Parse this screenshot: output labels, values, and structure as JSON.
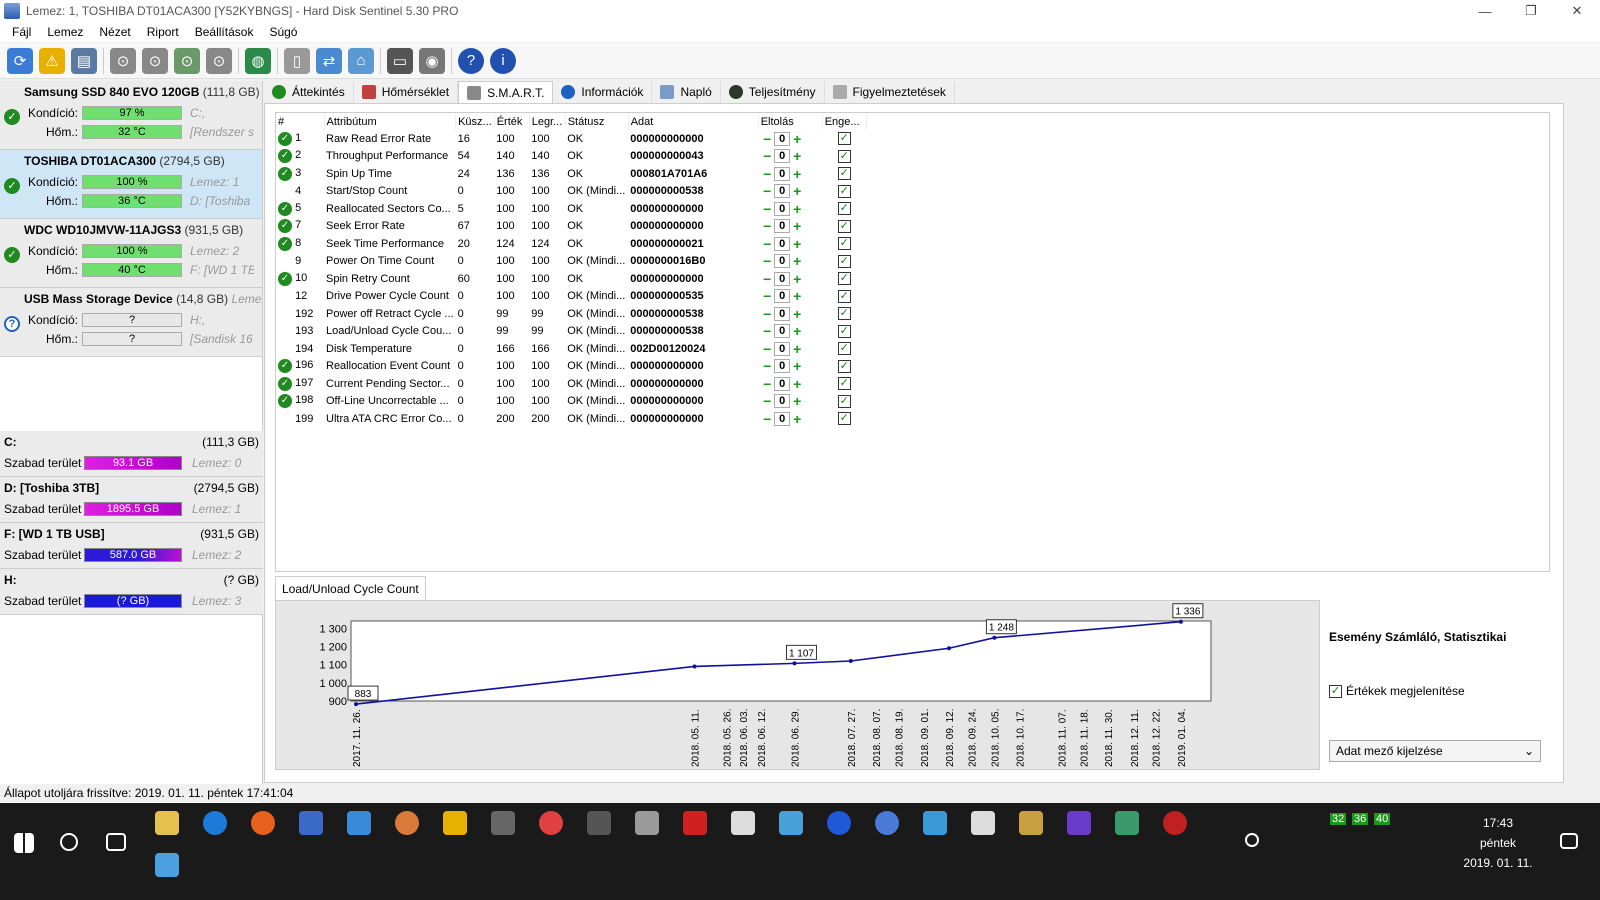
{
  "window": {
    "title": "Lemez: 1, TOSHIBA DT01ACA300 [Y52KYBNGS]  -  Hard Disk Sentinel 5.30 PRO",
    "btn_min": "—",
    "btn_max": "❐",
    "btn_close": "✕"
  },
  "menu": [
    "Fájl",
    "Lemez",
    "Nézet",
    "Riport",
    "Beállítások",
    "Súgó"
  ],
  "disks": [
    {
      "name": "Samsung SSD 840 EVO 120GB",
      "size": "(111,8 GB)",
      "tail": "Le",
      "cond_label": "Kondíció:",
      "cond": "97 %",
      "temp_label": "Hőm.:",
      "temp": "32 °C",
      "extra1": "C:,",
      "extra2": "[Rendszer sz",
      "status": "✓"
    },
    {
      "name": "TOSHIBA DT01ACA300",
      "size": "(2794,5 GB)",
      "tail": "",
      "cond_label": "Kondíció:",
      "cond": "100 %",
      "temp_label": "Hőm.:",
      "temp": "36 °C",
      "extra1": "Lemez: 1",
      "extra2": "D: [Toshiba 3",
      "status": "✓"
    },
    {
      "name": "WDC WD10JMVW-11AJGS3",
      "size": "(931,5 GB)",
      "tail": "",
      "cond_label": "Kondíció:",
      "cond": "100 %",
      "temp_label": "Hőm.:",
      "temp": "40 °C",
      "extra1": "Lemez: 2",
      "extra2": "F: [WD 1 TB U",
      "status": "✓"
    },
    {
      "name": "USB Mass Storage Device",
      "size": "(14,8 GB)",
      "tail": "Lemez",
      "cond_label": "Kondíció:",
      "cond": "?",
      "temp_label": "Hőm.:",
      "temp": "?",
      "extra1": "H:,",
      "extra2": "[Sandisk 16 G",
      "status": "?"
    }
  ],
  "partitions": [
    {
      "name": "C:",
      "size": "(111,3 GB)",
      "free_label": "Szabad terület",
      "free": "93.1 GB",
      "disk": "Lemez: 0"
    },
    {
      "name": "D: [Toshiba 3TB]",
      "size": "(2794,5 GB)",
      "free_label": "Szabad terület",
      "free": "1895.5 GB",
      "disk": "Lemez: 1"
    },
    {
      "name": "F: [WD 1 TB USB]",
      "size": "(931,5 GB)",
      "free_label": "Szabad terület",
      "free": "587.0 GB",
      "disk": "Lemez: 2"
    },
    {
      "name": "H:",
      "size": "(? GB)",
      "free_label": "Szabad terület",
      "free": "(? GB)",
      "disk": "Lemez: 3"
    }
  ],
  "tabs": [
    "Áttekintés",
    "Hőmérséklet",
    "S.M.A.R.T.",
    "Információk",
    "Napló",
    "Teljesítmény",
    "Figyelmeztetések"
  ],
  "smart_headers": [
    "#",
    "Attribútum",
    "Küsz...",
    "Érték",
    "Legr...",
    "Státusz",
    "Adat",
    "Eltolás",
    "Enge..."
  ],
  "smart_rows": [
    {
      "ok": true,
      "id": "1",
      "name": "Raw Read Error Rate",
      "thr": "16",
      "val": "100",
      "worst": "100",
      "status": "OK",
      "data": "000000000000",
      "offset": "0"
    },
    {
      "ok": true,
      "id": "2",
      "name": "Throughput Performance",
      "thr": "54",
      "val": "140",
      "worst": "140",
      "status": "OK",
      "data": "000000000043",
      "offset": "0"
    },
    {
      "ok": true,
      "id": "3",
      "name": "Spin Up Time",
      "thr": "24",
      "val": "136",
      "worst": "136",
      "status": "OK",
      "data": "000801A701A6",
      "offset": "0"
    },
    {
      "ok": false,
      "id": "4",
      "name": "Start/Stop Count",
      "thr": "0",
      "val": "100",
      "worst": "100",
      "status": "OK (Mindi...",
      "data": "000000000538",
      "offset": "0"
    },
    {
      "ok": true,
      "id": "5",
      "name": "Reallocated Sectors Co...",
      "thr": "5",
      "val": "100",
      "worst": "100",
      "status": "OK",
      "data": "000000000000",
      "offset": "0"
    },
    {
      "ok": true,
      "id": "7",
      "name": "Seek Error Rate",
      "thr": "67",
      "val": "100",
      "worst": "100",
      "status": "OK",
      "data": "000000000000",
      "offset": "0"
    },
    {
      "ok": true,
      "id": "8",
      "name": "Seek Time Performance",
      "thr": "20",
      "val": "124",
      "worst": "124",
      "status": "OK",
      "data": "000000000021",
      "offset": "0"
    },
    {
      "ok": false,
      "id": "9",
      "name": "Power On Time Count",
      "thr": "0",
      "val": "100",
      "worst": "100",
      "status": "OK (Mindi...",
      "data": "0000000016B0",
      "offset": "0"
    },
    {
      "ok": true,
      "id": "10",
      "name": "Spin Retry Count",
      "thr": "60",
      "val": "100",
      "worst": "100",
      "status": "OK",
      "data": "000000000000",
      "offset": "0"
    },
    {
      "ok": false,
      "id": "12",
      "name": "Drive Power Cycle Count",
      "thr": "0",
      "val": "100",
      "worst": "100",
      "status": "OK (Mindi...",
      "data": "000000000535",
      "offset": "0"
    },
    {
      "ok": false,
      "id": "192",
      "name": "Power off Retract Cycle ...",
      "thr": "0",
      "val": "99",
      "worst": "99",
      "status": "OK (Mindi...",
      "data": "000000000538",
      "offset": "0"
    },
    {
      "ok": false,
      "id": "193",
      "name": "Load/Unload Cycle Cou...",
      "thr": "0",
      "val": "99",
      "worst": "99",
      "status": "OK (Mindi...",
      "data": "000000000538",
      "offset": "0"
    },
    {
      "ok": false,
      "id": "194",
      "name": "Disk Temperature",
      "thr": "0",
      "val": "166",
      "worst": "166",
      "status": "OK (Mindi...",
      "data": "002D00120024",
      "offset": "0"
    },
    {
      "ok": true,
      "id": "196",
      "name": "Reallocation Event Count",
      "thr": "0",
      "val": "100",
      "worst": "100",
      "status": "OK (Mindi...",
      "data": "000000000000",
      "offset": "0"
    },
    {
      "ok": true,
      "id": "197",
      "name": "Current Pending Sector...",
      "thr": "0",
      "val": "100",
      "worst": "100",
      "status": "OK (Mindi...",
      "data": "000000000000",
      "offset": "0"
    },
    {
      "ok": true,
      "id": "198",
      "name": "Off-Line Uncorrectable ...",
      "thr": "0",
      "val": "100",
      "worst": "100",
      "status": "OK (Mindi...",
      "data": "000000000000",
      "offset": "0"
    },
    {
      "ok": false,
      "id": "199",
      "name": "Ultra ATA CRC Error Co...",
      "thr": "0",
      "val": "200",
      "worst": "200",
      "status": "OK (Mindi...",
      "data": "000000000000",
      "offset": "0"
    }
  ],
  "chart_tab": "Load/Unload Cycle Count",
  "chart_data": {
    "type": "line",
    "title": "",
    "yticks": [
      "1 300",
      "1 200",
      "1 100",
      "1 000",
      "900"
    ],
    "ylim": [
      900,
      1340
    ],
    "xticks": [
      "2017. 11. 26.",
      "2018. 05. 11.",
      "2018. 05. 26.",
      "2018. 06. 03.",
      "2018. 06. 12.",
      "2018. 06. 29.",
      "2018. 07. 27.",
      "2018. 08. 07.",
      "2018. 08. 19.",
      "2018. 09. 01.",
      "2018. 09. 12.",
      "2018. 09. 24.",
      "2018. 10. 05.",
      "2018. 10. 17.",
      "2018. 11. 07.",
      "2018. 11. 18.",
      "2018. 11. 30.",
      "2018. 12. 11.",
      "2018. 12. 22.",
      "2019. 01. 04."
    ],
    "points": [
      {
        "x": "2017. 11. 26.",
        "y": 883
      },
      {
        "x": "2018. 05. 11.",
        "y": 1090
      },
      {
        "x": "2018. 06. 29.",
        "y": 1107
      },
      {
        "x": "2018. 07. 27.",
        "y": 1120
      },
      {
        "x": "2018. 09. 12.",
        "y": 1190
      },
      {
        "x": "2018. 10. 05.",
        "y": 1248
      },
      {
        "x": "2019. 01. 04.",
        "y": 1336
      }
    ],
    "labels": [
      "883",
      "1 107",
      "1 248",
      "1 336"
    ],
    "grid": false
  },
  "right_panel": {
    "title": "Esemény Számláló, Statisztikai",
    "checkbox": "Értékek megjelenítése",
    "select": "Adat mező kijelzése"
  },
  "status_bar": "Állapot utoljára frissítve: 2019. 01. 11. péntek 17:41:04",
  "taskbar": {
    "time": "17:43",
    "day": "péntek",
    "date": "2019. 01. 11.",
    "tray_temps": [
      "32",
      "36",
      "40"
    ]
  }
}
